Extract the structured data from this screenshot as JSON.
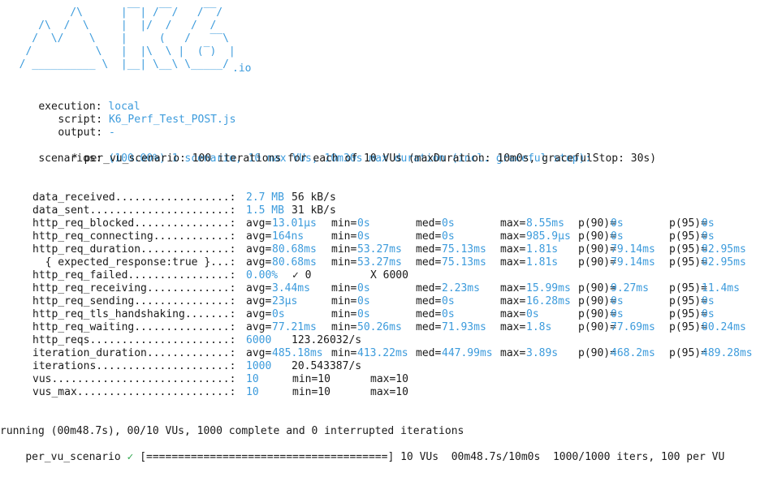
{
  "logo": {
    "lines": [
      "          /\\      |‾‾| /‾‾/   /‾‾/",
      "     /\\  /  \\     |  |/  /   /  /",
      "    /  \\/    \\    |     (   /   ‾‾\\",
      "   /          \\   |  |\\  \\ |  (‾)  |",
      "  / __________ \\  |__| \\__\\ \\_____/"
    ],
    "suffix": ".io"
  },
  "header": {
    "execution_label": "execution:",
    "execution_value": "local",
    "script_label": "script:",
    "script_value": "K6_Perf_Test_POST.js",
    "output_label": "output:",
    "output_value": "-"
  },
  "scenarios": {
    "label": "scenarios:",
    "summary": "(100.00%) 1 scenario, 10 max VUs, 10m30s max duration (incl. graceful stop):",
    "detail": "* per_vu_scenario: 100 iterations for each of 10 VUs (maxDuration: 10m0s, gracefulStop: 30s)"
  },
  "metrics": [
    {
      "name": "data_received..................:",
      "cols": [
        {
          "t": "2.7 MB",
          "c": "val"
        },
        {
          "t": "56 kB/s",
          "c": "dark"
        }
      ]
    },
    {
      "name": "data_sent......................:",
      "cols": [
        {
          "t": "1.5 MB",
          "c": "val"
        },
        {
          "t": "31 kB/s",
          "c": "dark"
        }
      ]
    },
    {
      "name": "http_req_blocked...............:",
      "stats": [
        "avg=",
        "13.01µs",
        "min=",
        "0s",
        "med=",
        "0s",
        "max=",
        "8.55ms",
        "p(90)=",
        "0s",
        "p(95)=",
        "0s"
      ]
    },
    {
      "name": "http_req_connecting............:",
      "stats": [
        "avg=",
        "164ns",
        "min=",
        "0s",
        "med=",
        "0s",
        "max=",
        "985.9µs",
        "p(90)=",
        "0s",
        "p(95)=",
        "0s"
      ]
    },
    {
      "name": "http_req_duration..............:",
      "stats": [
        "avg=",
        "80.68ms",
        "min=",
        "53.27ms",
        "med=",
        "75.13ms",
        "max=",
        "1.81s",
        "p(90)=",
        "79.14ms",
        "p(95)=",
        "82.95ms"
      ]
    },
    {
      "name": "  { expected_response:true }...:",
      "stats": [
        "avg=",
        "80.68ms",
        "min=",
        "53.27ms",
        "med=",
        "75.13ms",
        "max=",
        "1.81s",
        "p(90)=",
        "79.14ms",
        "p(95)=",
        "82.95ms"
      ]
    },
    {
      "name": "http_req_failed................:",
      "failed": {
        "pct": "0.00%",
        "ok": "✓ 0",
        "fail": "X 6000"
      }
    },
    {
      "name": "http_req_receiving.............:",
      "stats": [
        "avg=",
        "3.44ms",
        "min=",
        "0s",
        "med=",
        "2.23ms",
        "max=",
        "15.99ms",
        "p(90)=",
        "9.27ms",
        "p(95)=",
        "11.4ms"
      ]
    },
    {
      "name": "http_req_sending...............:",
      "stats": [
        "avg=",
        "23µs",
        "min=",
        "0s",
        "med=",
        "0s",
        "max=",
        "16.28ms",
        "p(90)=",
        "0s",
        "p(95)=",
        "0s"
      ]
    },
    {
      "name": "http_req_tls_handshaking.......:",
      "stats": [
        "avg=",
        "0s",
        "min=",
        "0s",
        "med=",
        "0s",
        "max=",
        "0s",
        "p(90)=",
        "0s",
        "p(95)=",
        "0s"
      ]
    },
    {
      "name": "http_req_waiting...............:",
      "stats": [
        "avg=",
        "77.21ms",
        "min=",
        "50.26ms",
        "med=",
        "71.93ms",
        "max=",
        "1.8s",
        "p(90)=",
        "77.69ms",
        "p(95)=",
        "80.24ms"
      ]
    },
    {
      "name": "http_reqs......................:",
      "cols": [
        {
          "t": "6000",
          "c": "val"
        },
        {
          "t": "123.26032/s",
          "c": "dark"
        }
      ]
    },
    {
      "name": "iteration_duration.............:",
      "stats": [
        "avg=",
        "485.18ms",
        "min=",
        "413.22ms",
        "med=",
        "447.99ms",
        "max=",
        "3.89s",
        "p(90)=",
        "468.2ms",
        "p(95)=",
        "489.28ms"
      ]
    },
    {
      "name": "iterations.....................:",
      "cols": [
        {
          "t": "1000",
          "c": "val"
        },
        {
          "t": "20.543387/s",
          "c": "dark"
        }
      ]
    },
    {
      "name": "vus............................:",
      "vus": [
        "10",
        "min=10",
        "max=10"
      ]
    },
    {
      "name": "vus_max........................:",
      "vus": [
        "10",
        "min=10",
        "max=10"
      ]
    }
  ],
  "footer": {
    "running": "running (00m48.7s), 00/10 VUs, 1000 complete and 0 interrupted iterations",
    "scenario_name": "per_vu_scenario",
    "check": "✓",
    "progress_bar": "[======================================]",
    "progress": 1.0,
    "summary": "10 VUs  00m48.7s/10m0s  1000/1000 iters, 100 per VU"
  },
  "colors": {
    "accent": "#3c9bdc",
    "text": "#1a1a1a",
    "check": "#2fa84f"
  }
}
